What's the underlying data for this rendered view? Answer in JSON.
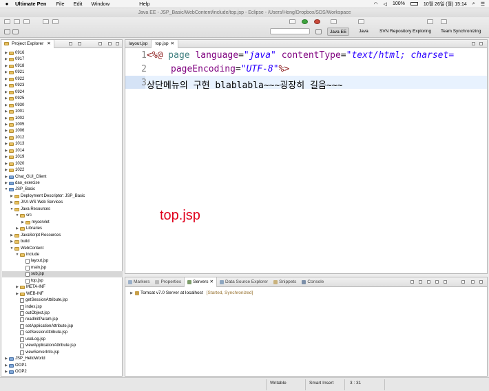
{
  "menubar": {
    "app": "Ultimate Pen",
    "items": [
      "File",
      "Edit",
      "Window",
      "Help"
    ],
    "battery": "100%",
    "datetime": "10월 26일 (월)  15:14"
  },
  "window_title": "Java EE - JSP_Basic/WebContent/include/top.jsp - Eclipse - /Users/Hong/Dropbox/SDS/Workspace",
  "perspectives": [
    "Java EE",
    "Java",
    "SVN Repository Exploring",
    "Team Synchronizing"
  ],
  "project_explorer": {
    "title": "Project Explorer",
    "items": [
      {
        "label": "0916",
        "depth": 0,
        "icon": "folder-icon",
        "exp": false
      },
      {
        "label": "0917",
        "depth": 0,
        "icon": "folder-icon",
        "exp": false
      },
      {
        "label": "0918",
        "depth": 0,
        "icon": "folder-icon",
        "exp": false
      },
      {
        "label": "0921",
        "depth": 0,
        "icon": "folder-icon",
        "exp": false
      },
      {
        "label": "0922",
        "depth": 0,
        "icon": "folder-icon",
        "exp": false
      },
      {
        "label": "0923",
        "depth": 0,
        "icon": "folder-icon",
        "exp": false
      },
      {
        "label": "0924",
        "depth": 0,
        "icon": "folder-icon",
        "exp": false
      },
      {
        "label": "0925",
        "depth": 0,
        "icon": "folder-icon",
        "exp": false
      },
      {
        "label": "0930",
        "depth": 0,
        "icon": "folder-icon",
        "exp": false
      },
      {
        "label": "1001",
        "depth": 0,
        "icon": "folder-icon",
        "exp": false
      },
      {
        "label": "1002",
        "depth": 0,
        "icon": "folder-icon",
        "exp": false
      },
      {
        "label": "1005",
        "depth": 0,
        "icon": "folder-icon",
        "exp": false
      },
      {
        "label": "1006",
        "depth": 0,
        "icon": "folder-icon",
        "exp": false
      },
      {
        "label": "1012",
        "depth": 0,
        "icon": "folder-icon",
        "exp": false
      },
      {
        "label": "1013",
        "depth": 0,
        "icon": "folder-icon",
        "exp": false
      },
      {
        "label": "1014",
        "depth": 0,
        "icon": "folder-icon",
        "exp": false
      },
      {
        "label": "1019",
        "depth": 0,
        "icon": "folder-icon",
        "exp": false
      },
      {
        "label": "1020",
        "depth": 0,
        "icon": "folder-icon",
        "exp": false
      },
      {
        "label": "1022",
        "depth": 0,
        "icon": "folder-icon",
        "exp": false
      },
      {
        "label": "Chat_GUI_Client",
        "depth": 0,
        "icon": "project-icon",
        "exp": false
      },
      {
        "label": "dao_exercise",
        "depth": 0,
        "icon": "project-icon",
        "exp": false
      },
      {
        "label": "JSP_Basic",
        "depth": 0,
        "icon": "project-icon",
        "exp": true
      },
      {
        "label": "Deployment Descriptor: JSP_Basic",
        "depth": 1,
        "icon": "descriptor-icon",
        "exp": false
      },
      {
        "label": "JAX-WS Web Services",
        "depth": 1,
        "icon": "webservice-icon",
        "exp": false
      },
      {
        "label": "Java Resources",
        "depth": 1,
        "icon": "folder-icon",
        "exp": true
      },
      {
        "label": "src",
        "depth": 2,
        "icon": "folder-icon",
        "exp": true
      },
      {
        "label": "myservlet",
        "depth": 3,
        "icon": "package-icon",
        "exp": false
      },
      {
        "label": "Libraries",
        "depth": 2,
        "icon": "library-icon",
        "exp": false
      },
      {
        "label": "JavaScript Resources",
        "depth": 1,
        "icon": "folder-icon",
        "exp": false
      },
      {
        "label": "build",
        "depth": 1,
        "icon": "folder-icon",
        "exp": false
      },
      {
        "label": "WebContent",
        "depth": 1,
        "icon": "folder-icon",
        "exp": true
      },
      {
        "label": "include",
        "depth": 2,
        "icon": "folder-icon",
        "exp": true
      },
      {
        "label": "layout.jsp",
        "depth": 3,
        "icon": "jsp-file-icon",
        "leaf": true
      },
      {
        "label": "main.jsp",
        "depth": 3,
        "icon": "jsp-file-icon",
        "leaf": true
      },
      {
        "label": "sub.jsp",
        "depth": 3,
        "icon": "jsp-file-icon",
        "leaf": true
      },
      {
        "label": "top.jsp",
        "depth": 3,
        "icon": "jsp-file-icon",
        "leaf": true
      },
      {
        "label": "META-INF",
        "depth": 2,
        "icon": "folder-icon",
        "exp": false
      },
      {
        "label": "WEB-INF",
        "depth": 2,
        "icon": "folder-icon",
        "exp": false
      },
      {
        "label": "getSessionAttribute.jsp",
        "depth": 2,
        "icon": "jsp-file-icon",
        "leaf": true
      },
      {
        "label": "index.jsp",
        "depth": 2,
        "icon": "jsp-file-icon",
        "leaf": true
      },
      {
        "label": "outObject.jsp",
        "depth": 2,
        "icon": "jsp-file-icon",
        "leaf": true
      },
      {
        "label": "readInitParam.jsp",
        "depth": 2,
        "icon": "jsp-file-icon",
        "leaf": true
      },
      {
        "label": "setApplicationAttribute.jsp",
        "depth": 2,
        "icon": "jsp-file-icon",
        "leaf": true
      },
      {
        "label": "setSessionAttribute.jsp",
        "depth": 2,
        "icon": "jsp-file-icon",
        "leaf": true
      },
      {
        "label": "useLog.jsp",
        "depth": 2,
        "icon": "jsp-file-icon",
        "leaf": true
      },
      {
        "label": "viewApplicationAttribute.jsp",
        "depth": 2,
        "icon": "jsp-file-icon",
        "leaf": true
      },
      {
        "label": "viewServerInfo.jsp",
        "depth": 2,
        "icon": "jsp-file-icon",
        "leaf": true
      },
      {
        "label": "JSP_HelloWorld",
        "depth": 0,
        "icon": "project-icon",
        "exp": false
      },
      {
        "label": "OOP1",
        "depth": 0,
        "icon": "project-icon",
        "exp": false
      },
      {
        "label": "OOP2",
        "depth": 0,
        "icon": "project-icon",
        "exp": false
      }
    ],
    "selected_index": 34
  },
  "editor": {
    "tabs": [
      "layout.jsp",
      "top.jsp"
    ],
    "active_tab": 1,
    "line_numbers": [
      "1",
      "2",
      "3"
    ],
    "line1": {
      "open": "<%@",
      "page": " page ",
      "language_attr": "language",
      "eq": "=",
      "language_val": "\"java\"",
      "ct_attr": " contentType",
      "ct_val": "\"text/html; charset="
    },
    "line2": {
      "enc_attr": "pageEncoding",
      "eq": "=",
      "enc_val": "\"UTF-8\"",
      "close": "%>"
    },
    "line3": "상단메뉴의 구현 blablabla~~~굉장히 길음~~~",
    "annotation": "top.jsp"
  },
  "bottom_panel": {
    "tabs": [
      "Markers",
      "Properties",
      "Servers",
      "Data Source Explorer",
      "Snippets",
      "Console"
    ],
    "active_tab": 2,
    "server": {
      "name": "Tomcat v7.0 Server at localhost",
      "state": "[Started, Synchronized]"
    }
  },
  "statusbar": {
    "mode": "Writable",
    "insert": "Smart Insert",
    "position": "3 : 31"
  },
  "colors": {
    "tag": "#8b1a1a",
    "attr": "#7f007f",
    "value": "#2a00ff",
    "annotation": "#e0001c",
    "selection": "#d7d7d7",
    "current_line": "#e8f2fe"
  }
}
